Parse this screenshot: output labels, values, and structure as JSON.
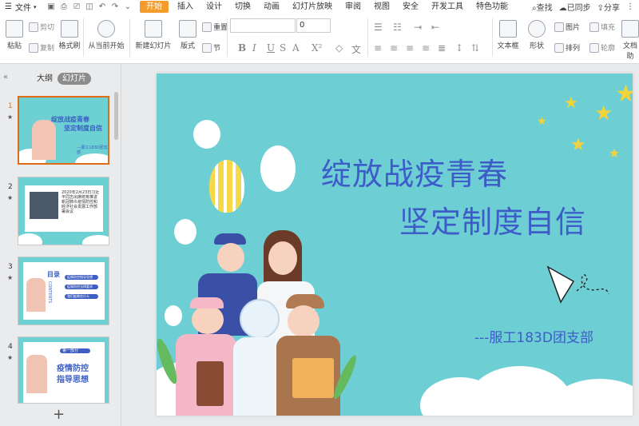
{
  "menubar": {
    "file_label": "文件",
    "tabs": [
      "开始",
      "插入",
      "设计",
      "切换",
      "动画",
      "幻灯片放映",
      "审阅",
      "视图",
      "安全",
      "开发工具",
      "特色功能"
    ],
    "active_tab": "开始",
    "search_label": "查找",
    "sync_label": "已同步",
    "share_label": "分享"
  },
  "ribbon": {
    "paste": "粘贴",
    "cut": "剪切",
    "copy": "复制",
    "format_painter": "格式刷",
    "from_current": "从当前开始",
    "new_slide": "新建幻灯片",
    "layout": "版式",
    "reset": "重置",
    "section": "节",
    "font_size": "0",
    "textbox": "文本框",
    "shape": "形状",
    "picture": "图片",
    "fill": "填充",
    "arrange": "排列",
    "outline": "轮廓",
    "doc_assist": "文档助"
  },
  "leftpanel": {
    "tab_outline": "大纲",
    "tab_slides": "幻灯片",
    "slides": [
      {
        "num": "1",
        "title1": "绽放战疫青春",
        "title2": "坚定制度自信",
        "sub": "---服工183D团支部"
      },
      {
        "num": "2",
        "text": "2020年2月23日习近平同志出席统筹推进新冠肺炎疫情防控和经济社会发展工作部署会议"
      },
      {
        "num": "3",
        "heading": "目录",
        "vertical": "CONTENTS",
        "items": [
          "疫情防控指导思想",
          "疫情防控法律要求",
          "我们能做些什么"
        ]
      },
      {
        "num": "4",
        "badge": "第一部分",
        "title1": "疫情防控",
        "title2": "指导思想"
      }
    ]
  },
  "slide": {
    "title_line1": "绽放战疫青春",
    "title_line2": "坚定制度自信",
    "subtitle": "---服工183D团支部"
  },
  "colors": {
    "accent": "#f39c2b",
    "slide_bg": "#6dcfd4",
    "title_blue": "#3d5cc7",
    "selection": "#e06c1a"
  }
}
